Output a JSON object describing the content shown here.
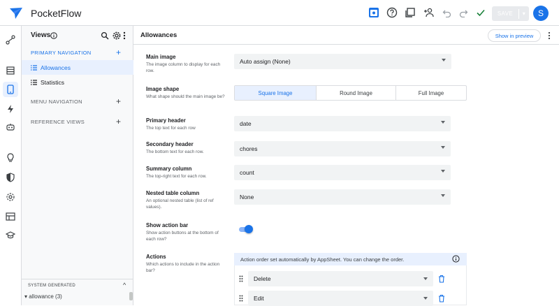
{
  "app": {
    "name": "PocketFlow",
    "brand_color": "#1a73e8"
  },
  "topbar": {
    "icons": [
      "preview-toggle-icon",
      "help-icon",
      "copy-icon",
      "share-user-icon",
      "undo-icon",
      "redo-icon",
      "check-icon"
    ],
    "save_label": "SAVE",
    "save_caret": "▾",
    "avatar_letter": "S"
  },
  "rail": {
    "icons": [
      "connections-icon",
      "data-icon",
      "app-icon",
      "automation-icon",
      "bot-icon",
      "idea-icon",
      "security-icon",
      "settings-icon",
      "manage-icon",
      "learn-icon"
    ],
    "active": "app-icon"
  },
  "views_panel": {
    "title": "Views",
    "info_icon": "i",
    "sections": [
      {
        "label": "PRIMARY NAVIGATION",
        "plus": "+",
        "items": [
          {
            "label": "Allowances",
            "active": true
          },
          {
            "label": "Statistics",
            "active": false
          }
        ]
      },
      {
        "label": "MENU NAVIGATION",
        "plus": "+",
        "items": []
      },
      {
        "label": "REFERENCE VIEWS",
        "plus": "+",
        "items": []
      }
    ],
    "system_generated": {
      "label": "SYSTEM GENERATED",
      "caret": "^",
      "items": [
        {
          "label": "▾ allowance (3)"
        }
      ]
    }
  },
  "main": {
    "title": "Allowances",
    "preview_button": "Show in preview",
    "rows": [
      {
        "label": "Main image",
        "desc": "The image column to display for each row.",
        "value": "Auto assign (None)"
      },
      {
        "label": "Image shape",
        "desc": "What shape should the main image be?",
        "options": [
          "Square Image",
          "Round Image",
          "Full Image"
        ],
        "selected": "Square Image"
      },
      {
        "label": "Primary header",
        "desc": "The top text for each row",
        "value": "date"
      },
      {
        "label": "Secondary header",
        "desc": "The bottom text for each row.",
        "value": "chores"
      },
      {
        "label": "Summary column",
        "desc": "The top-right text for each row.",
        "value": "count"
      },
      {
        "label": "Nested table column",
        "desc": "An optional nested table (list of ref values).",
        "value": "None"
      },
      {
        "label": "Show action bar",
        "desc": "Show action buttons at the bottom of each row?",
        "toggle": true
      },
      {
        "label": "Actions",
        "desc": "Which actions to include in the action bar?",
        "info": "Action order set automatically by AppSheet. You can change the order.",
        "actions": [
          "Delete",
          "Edit"
        ]
      }
    ]
  }
}
